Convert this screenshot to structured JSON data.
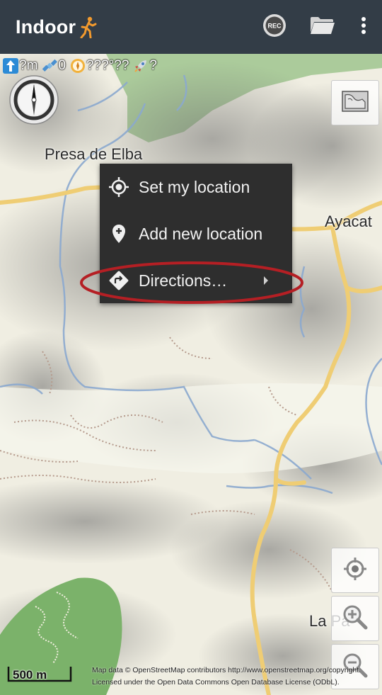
{
  "appbar": {
    "title": "Indoor",
    "title_icon": "runner-icon",
    "actions": [
      {
        "name": "rec-icon",
        "label": "REC"
      },
      {
        "name": "folder-icon"
      },
      {
        "name": "overflow-menu-icon"
      }
    ],
    "background": "#333d47"
  },
  "status": {
    "altitude": "?m",
    "satellites": "0",
    "coordinates": "???°??",
    "speed": "?"
  },
  "map": {
    "places": [
      "Presa de Elba",
      "Ayacat",
      "La Pa"
    ],
    "scale_label": "500 m",
    "attribution_line1": "Map data © OpenStreetMap contributors http://www.openstreetmap.org/copyright.",
    "attribution_line2": "Licensed under the Open Data Commons Open Database License (ODbL)."
  },
  "context_menu": {
    "items": [
      {
        "label": "Set my location",
        "icon": "crosshair-location-icon"
      },
      {
        "label": "Add new location",
        "icon": "add-pin-icon"
      },
      {
        "label": "Directions…",
        "icon": "directions-icon",
        "has_submenu": true
      }
    ],
    "highlight_color": "#b51f24"
  },
  "map_buttons": [
    "layers-map-icon",
    "my-location-icon",
    "zoom-in-icon",
    "zoom-out-icon"
  ]
}
